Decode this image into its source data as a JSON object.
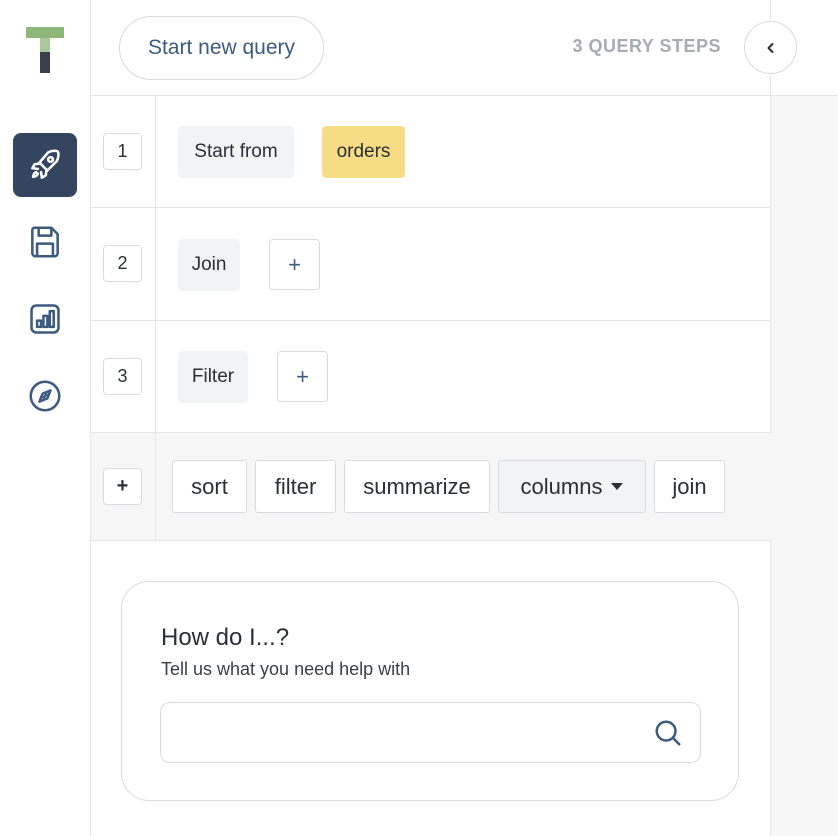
{
  "sidebar": {
    "items": [
      {
        "icon": "rocket-icon",
        "active": true
      },
      {
        "icon": "save-icon",
        "active": false
      },
      {
        "icon": "chart-icon",
        "active": false
      },
      {
        "icon": "compass-icon",
        "active": false
      }
    ]
  },
  "header": {
    "start_label": "Start new query",
    "steps_label": "3 QUERY STEPS"
  },
  "steps": [
    {
      "number": "1",
      "label": "Start from",
      "value": "orders"
    },
    {
      "number": "2",
      "label": "Join",
      "add": "+"
    },
    {
      "number": "3",
      "label": "Filter",
      "add": "+"
    }
  ],
  "add_row": {
    "add": "+",
    "actions": [
      "sort",
      "filter",
      "summarize",
      "columns",
      "join"
    ]
  },
  "help": {
    "title": "How do I...?",
    "subtitle": "Tell us what you need help with",
    "placeholder": ""
  },
  "colors": {
    "accent": "#34455f",
    "highlight": "#f7dc86",
    "brand_green": "#8fb77a"
  }
}
